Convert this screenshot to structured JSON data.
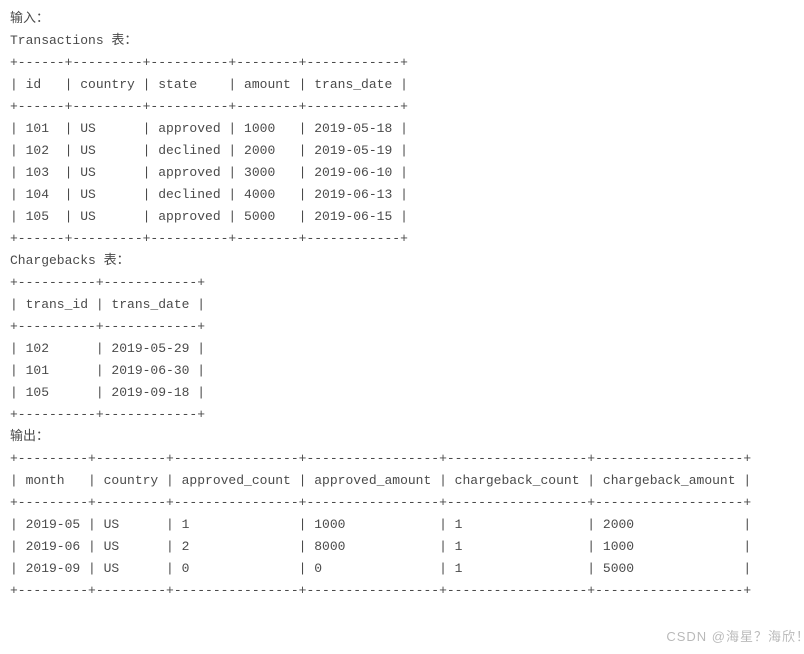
{
  "labels": {
    "input": "输入：",
    "output": "输出：",
    "transactions_caption": "Transactions 表：",
    "chargebacks_caption": "Chargebacks 表："
  },
  "transactions": {
    "border": "+------+---------+----------+--------+------------+",
    "header": "| id   | country | state    | amount | trans_date |",
    "columns": [
      "id",
      "country",
      "state",
      "amount",
      "trans_date"
    ],
    "rows": [
      {
        "id": 101,
        "country": "US",
        "state": "approved",
        "amount": 1000,
        "trans_date": "2019-05-18",
        "line": "| 101  | US      | approved | 1000   | 2019-05-18 |"
      },
      {
        "id": 102,
        "country": "US",
        "state": "declined",
        "amount": 2000,
        "trans_date": "2019-05-19",
        "line": "| 102  | US      | declined | 2000   | 2019-05-19 |"
      },
      {
        "id": 103,
        "country": "US",
        "state": "approved",
        "amount": 3000,
        "trans_date": "2019-06-10",
        "line": "| 103  | US      | approved | 3000   | 2019-06-10 |"
      },
      {
        "id": 104,
        "country": "US",
        "state": "declined",
        "amount": 4000,
        "trans_date": "2019-06-13",
        "line": "| 104  | US      | declined | 4000   | 2019-06-13 |"
      },
      {
        "id": 105,
        "country": "US",
        "state": "approved",
        "amount": 5000,
        "trans_date": "2019-06-15",
        "line": "| 105  | US      | approved | 5000   | 2019-06-15 |"
      }
    ]
  },
  "chargebacks": {
    "border": "+----------+------------+",
    "header": "| trans_id | trans_date |",
    "columns": [
      "trans_id",
      "trans_date"
    ],
    "rows": [
      {
        "trans_id": 102,
        "trans_date": "2019-05-29",
        "line": "| 102      | 2019-05-29 |"
      },
      {
        "trans_id": 101,
        "trans_date": "2019-06-30",
        "line": "| 101      | 2019-06-30 |"
      },
      {
        "trans_id": 105,
        "trans_date": "2019-09-18",
        "line": "| 105      | 2019-09-18 |"
      }
    ]
  },
  "output_table": {
    "border": "+---------+---------+----------------+-----------------+------------------+-------------------+",
    "header": "| month   | country | approved_count | approved_amount | chargeback_count | chargeback_amount |",
    "columns": [
      "month",
      "country",
      "approved_count",
      "approved_amount",
      "chargeback_count",
      "chargeback_amount"
    ],
    "rows": [
      {
        "month": "2019-05",
        "country": "US",
        "approved_count": 1,
        "approved_amount": 1000,
        "chargeback_count": 1,
        "chargeback_amount": 2000,
        "line": "| 2019-05 | US      | 1              | 1000            | 1                | 2000              |"
      },
      {
        "month": "2019-06",
        "country": "US",
        "approved_count": 2,
        "approved_amount": 8000,
        "chargeback_count": 1,
        "chargeback_amount": 1000,
        "line": "| 2019-06 | US      | 2              | 8000            | 1                | 1000              |"
      },
      {
        "month": "2019-09",
        "country": "US",
        "approved_count": 0,
        "approved_amount": 0,
        "chargeback_count": 1,
        "chargeback_amount": 5000,
        "line": "| 2019-09 | US      | 0              | 0               | 1                | 5000              |"
      }
    ]
  },
  "watermark": "CSDN @海星？海欣！"
}
